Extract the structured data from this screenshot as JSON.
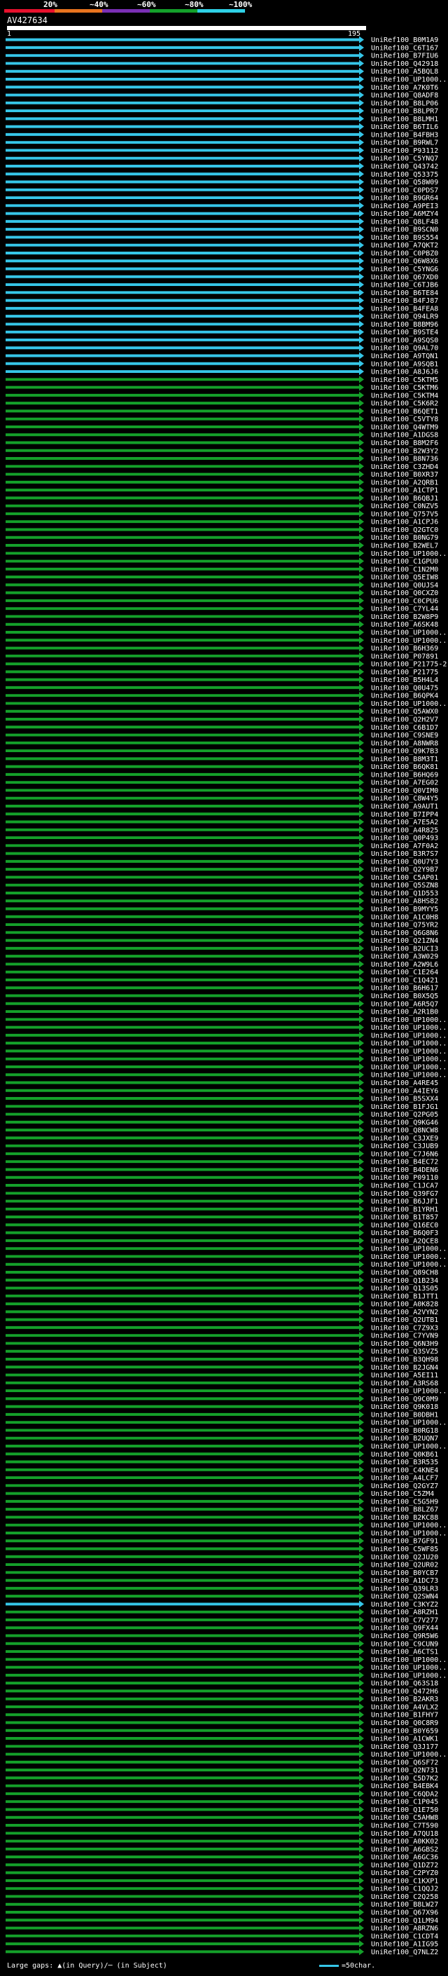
{
  "legend": {
    "labels": [
      "20%",
      "~40%",
      "~60%",
      "~80%",
      "~100%"
    ],
    "colors": [
      "#e8112d",
      "#e8741f",
      "#7a2fb5",
      "#14a02a",
      "#2fd0e6"
    ]
  },
  "query": {
    "id": "AV427634",
    "start": "1",
    "end": "195"
  },
  "hits": [
    {
      "name": "UniRef100_B0M1A9",
      "color": "#36c6e8"
    },
    {
      "name": "UniRef100_C6T167",
      "color": "#36c6e8"
    },
    {
      "name": "UniRef100_B7FIU6",
      "color": "#36c6e8"
    },
    {
      "name": "UniRef100_Q42918",
      "color": "#36c6e8"
    },
    {
      "name": "UniRef100_A5BQL8",
      "color": "#36c6e8"
    },
    {
      "name": "UniRef100_UP1000..",
      "color": "#36c6e8"
    },
    {
      "name": "UniRef100_A7K0T6",
      "color": "#36c6e8"
    },
    {
      "name": "UniRef100_Q8ADF8",
      "color": "#36c6e8"
    },
    {
      "name": "UniRef100_B8LP06",
      "color": "#36c6e8"
    },
    {
      "name": "UniRef100_B8LPR7",
      "color": "#36c6e8"
    },
    {
      "name": "UniRef100_B8LMH1",
      "color": "#36c6e8"
    },
    {
      "name": "UniRef100_B6TIL6",
      "color": "#36c6e8"
    },
    {
      "name": "UniRef100_B4FBH3",
      "color": "#36c6e8"
    },
    {
      "name": "UniRef100_B9RWL7",
      "color": "#36c6e8"
    },
    {
      "name": "UniRef100_P93112",
      "color": "#36c6e8"
    },
    {
      "name": "UniRef100_C5YNQ7",
      "color": "#36c6e8"
    },
    {
      "name": "UniRef100_Q43742",
      "color": "#36c6e8"
    },
    {
      "name": "UniRef100_Q53375",
      "color": "#36c6e8"
    },
    {
      "name": "UniRef100_Q58W09",
      "color": "#36c6e8"
    },
    {
      "name": "UniRef100_C0PDS7",
      "color": "#36c6e8"
    },
    {
      "name": "UniRef100_B9GR64",
      "color": "#36c6e8"
    },
    {
      "name": "UniRef100_A9PEI3",
      "color": "#36c6e8"
    },
    {
      "name": "UniRef100_A6MZY4",
      "color": "#36c6e8"
    },
    {
      "name": "UniRef100_Q8LF48",
      "color": "#36c6e8"
    },
    {
      "name": "UniRef100_B9SCN0",
      "color": "#36c6e8"
    },
    {
      "name": "UniRef100_B9S554",
      "color": "#36c6e8"
    },
    {
      "name": "UniRef100_A7QKT2",
      "color": "#36c6e8"
    },
    {
      "name": "UniRef100_C0PBZ0",
      "color": "#36c6e8"
    },
    {
      "name": "UniRef100_Q6W8X6",
      "color": "#36c6e8"
    },
    {
      "name": "UniRef100_C5YNG6",
      "color": "#36c6e8"
    },
    {
      "name": "UniRef100_Q67XD0",
      "color": "#36c6e8"
    },
    {
      "name": "UniRef100_C6TJB6",
      "color": "#36c6e8"
    },
    {
      "name": "UniRef100_B6TE84",
      "color": "#36c6e8"
    },
    {
      "name": "UniRef100_B4FJ87",
      "color": "#36c6e8"
    },
    {
      "name": "UniRef100_B4FEA8",
      "color": "#36c6e8"
    },
    {
      "name": "UniRef100_Q94LR9",
      "color": "#36c6e8"
    },
    {
      "name": "UniRef100_B8BM96",
      "color": "#36c6e8"
    },
    {
      "name": "UniRef100_B9STE4",
      "color": "#36c6e8"
    },
    {
      "name": "UniRef100_A9SQS0",
      "color": "#36c6e8"
    },
    {
      "name": "UniRef100_Q9AL70",
      "color": "#36c6e8"
    },
    {
      "name": "UniRef100_A9TQN1",
      "color": "#36c6e8"
    },
    {
      "name": "UniRef100_A9SQB1",
      "color": "#36c6e8"
    },
    {
      "name": "UniRef100_A8J6J6",
      "color": "#36c6e8"
    },
    {
      "name": "UniRef100_C5KTM5",
      "color": "#14a02a"
    },
    {
      "name": "UniRef100_C5KTM6",
      "color": "#14a02a"
    },
    {
      "name": "UniRef100_C5KTM4",
      "color": "#14a02a"
    },
    {
      "name": "UniRef100_C5K6R2",
      "color": "#14a02a"
    },
    {
      "name": "UniRef100_B6QET1",
      "color": "#14a02a"
    },
    {
      "name": "UniRef100_C5VTY8",
      "color": "#14a02a"
    },
    {
      "name": "UniRef100_Q4WTM9",
      "color": "#14a02a"
    },
    {
      "name": "UniRef100_A1DGS8",
      "color": "#14a02a"
    },
    {
      "name": "UniRef100_B8M2F6",
      "color": "#14a02a"
    },
    {
      "name": "UniRef100_B2W3Y2",
      "color": "#14a02a"
    },
    {
      "name": "UniRef100_B8N736",
      "color": "#14a02a"
    },
    {
      "name": "UniRef100_C3ZHD4",
      "color": "#14a02a"
    },
    {
      "name": "UniRef100_B0XR37",
      "color": "#14a02a"
    },
    {
      "name": "UniRef100_A2QRB1",
      "color": "#14a02a"
    },
    {
      "name": "UniRef100_A1CTP1",
      "color": "#14a02a"
    },
    {
      "name": "UniRef100_B6QBJ1",
      "color": "#14a02a"
    },
    {
      "name": "UniRef100_C0NZV5",
      "color": "#14a02a"
    },
    {
      "name": "UniRef100_Q757V5",
      "color": "#14a02a"
    },
    {
      "name": "UniRef100_A1CPJ6",
      "color": "#14a02a"
    },
    {
      "name": "UniRef100_Q2GTC0",
      "color": "#14a02a"
    },
    {
      "name": "UniRef100_B0NG79",
      "color": "#14a02a"
    },
    {
      "name": "UniRef100_B2WEL7",
      "color": "#14a02a"
    },
    {
      "name": "UniRef100_UP1000..",
      "color": "#14a02a"
    },
    {
      "name": "UniRef100_C1GPU0",
      "color": "#14a02a"
    },
    {
      "name": "UniRef100_C1N2M0",
      "color": "#14a02a"
    },
    {
      "name": "UniRef100_Q5EIW8",
      "color": "#14a02a"
    },
    {
      "name": "UniRef100_Q0UJS4",
      "color": "#14a02a"
    },
    {
      "name": "UniRef100_Q0CXZ0",
      "color": "#14a02a"
    },
    {
      "name": "UniRef100_C0CPU6",
      "color": "#14a02a"
    },
    {
      "name": "UniRef100_C7YL44",
      "color": "#14a02a"
    },
    {
      "name": "UniRef100_B2W8P9",
      "color": "#14a02a"
    },
    {
      "name": "UniRef100_A6SK48",
      "color": "#14a02a"
    },
    {
      "name": "UniRef100_UP1000..",
      "color": "#14a02a"
    },
    {
      "name": "UniRef100_UP1000..",
      "color": "#14a02a"
    },
    {
      "name": "UniRef100_B6H369",
      "color": "#14a02a"
    },
    {
      "name": "UniRef100_P07891",
      "color": "#14a02a"
    },
    {
      "name": "UniRef100_P21775-2",
      "color": "#14a02a"
    },
    {
      "name": "UniRef100_P21775",
      "color": "#14a02a"
    },
    {
      "name": "UniRef100_B5H4L4",
      "color": "#14a02a"
    },
    {
      "name": "UniRef100_Q0U475",
      "color": "#14a02a"
    },
    {
      "name": "UniRef100_B6QPK4",
      "color": "#14a02a"
    },
    {
      "name": "UniRef100_UP1000..",
      "color": "#14a02a"
    },
    {
      "name": "UniRef100_Q5AWX0",
      "color": "#14a02a"
    },
    {
      "name": "UniRef100_Q2H2V7",
      "color": "#14a02a"
    },
    {
      "name": "UniRef100_C6B1D7",
      "color": "#14a02a"
    },
    {
      "name": "UniRef100_C9SNE9",
      "color": "#14a02a"
    },
    {
      "name": "UniRef100_A8NWR8",
      "color": "#14a02a"
    },
    {
      "name": "UniRef100_Q9K7B3",
      "color": "#14a02a"
    },
    {
      "name": "UniRef100_B8M3T1",
      "color": "#14a02a"
    },
    {
      "name": "UniRef100_B6QK81",
      "color": "#14a02a"
    },
    {
      "name": "UniRef100_B6HQ69",
      "color": "#14a02a"
    },
    {
      "name": "UniRef100_A7EG02",
      "color": "#14a02a"
    },
    {
      "name": "UniRef100_Q0VIM0",
      "color": "#14a02a"
    },
    {
      "name": "UniRef100_C8W4Y5",
      "color": "#14a02a"
    },
    {
      "name": "UniRef100_A9AUT1",
      "color": "#14a02a"
    },
    {
      "name": "UniRef100_B7IPP4",
      "color": "#14a02a"
    },
    {
      "name": "UniRef100_A7E5A2",
      "color": "#14a02a"
    },
    {
      "name": "UniRef100_A4R825",
      "color": "#14a02a"
    },
    {
      "name": "UniRef100_Q0P493",
      "color": "#14a02a"
    },
    {
      "name": "UniRef100_A7F0A2",
      "color": "#14a02a"
    },
    {
      "name": "UniRef100_B3R7S7",
      "color": "#14a02a"
    },
    {
      "name": "UniRef100_Q0U7Y3",
      "color": "#14a02a"
    },
    {
      "name": "UniRef100_Q2Y9B7",
      "color": "#14a02a"
    },
    {
      "name": "UniRef100_C5AP01",
      "color": "#14a02a"
    },
    {
      "name": "UniRef100_Q5SZN8",
      "color": "#14a02a"
    },
    {
      "name": "UniRef100_Q1D553",
      "color": "#14a02a"
    },
    {
      "name": "UniRef100_A8HS82",
      "color": "#14a02a"
    },
    {
      "name": "UniRef100_B9MYY5",
      "color": "#14a02a"
    },
    {
      "name": "UniRef100_A1C0H8",
      "color": "#14a02a"
    },
    {
      "name": "UniRef100_Q75YR2",
      "color": "#14a02a"
    },
    {
      "name": "UniRef100_Q6G8N6",
      "color": "#14a02a"
    },
    {
      "name": "UniRef100_Q21ZN4",
      "color": "#14a02a"
    },
    {
      "name": "UniRef100_B2UCI3",
      "color": "#14a02a"
    },
    {
      "name": "UniRef100_A3W029",
      "color": "#14a02a"
    },
    {
      "name": "UniRef100_A2W9L6",
      "color": "#14a02a"
    },
    {
      "name": "UniRef100_C1E264",
      "color": "#14a02a"
    },
    {
      "name": "UniRef100_C1Q421",
      "color": "#14a02a"
    },
    {
      "name": "UniRef100_B6H617",
      "color": "#14a02a"
    },
    {
      "name": "UniRef100_B0X5Q5",
      "color": "#14a02a"
    },
    {
      "name": "UniRef100_A6R5Q7",
      "color": "#14a02a"
    },
    {
      "name": "UniRef100_A2R1B0",
      "color": "#14a02a"
    },
    {
      "name": "UniRef100_UP1000..",
      "color": "#14a02a"
    },
    {
      "name": "UniRef100_UP1000..",
      "color": "#14a02a"
    },
    {
      "name": "UniRef100_UP1000..",
      "color": "#14a02a"
    },
    {
      "name": "UniRef100_UP1000..",
      "color": "#14a02a"
    },
    {
      "name": "UniRef100_UP1000..",
      "color": "#14a02a"
    },
    {
      "name": "UniRef100_UP1000..",
      "color": "#14a02a"
    },
    {
      "name": "UniRef100_UP1000..",
      "color": "#14a02a"
    },
    {
      "name": "UniRef100_UP1000..",
      "color": "#14a02a"
    },
    {
      "name": "UniRef100_A4RE45",
      "color": "#14a02a"
    },
    {
      "name": "UniRef100_A4IEY6",
      "color": "#14a02a"
    },
    {
      "name": "UniRef100_B5SXX4",
      "color": "#14a02a"
    },
    {
      "name": "UniRef100_B1FJG1",
      "color": "#14a02a"
    },
    {
      "name": "UniRef100_Q2PG05",
      "color": "#14a02a"
    },
    {
      "name": "UniRef100_Q9KG46",
      "color": "#14a02a"
    },
    {
      "name": "UniRef100_Q8NCW8",
      "color": "#14a02a"
    },
    {
      "name": "UniRef100_C3JXE9",
      "color": "#14a02a"
    },
    {
      "name": "UniRef100_C3JUB9",
      "color": "#14a02a"
    },
    {
      "name": "UniRef100_C7J6N6",
      "color": "#14a02a"
    },
    {
      "name": "UniRef100_B4EC72",
      "color": "#14a02a"
    },
    {
      "name": "UniRef100_B4DEN6",
      "color": "#14a02a"
    },
    {
      "name": "UniRef100_P09110",
      "color": "#14a02a"
    },
    {
      "name": "UniRef100_C1JCA7",
      "color": "#14a02a"
    },
    {
      "name": "UniRef100_Q39FG7",
      "color": "#14a02a"
    },
    {
      "name": "UniRef100_B6JJF1",
      "color": "#14a02a"
    },
    {
      "name": "UniRef100_B1YRH1",
      "color": "#14a02a"
    },
    {
      "name": "UniRef100_B1T857",
      "color": "#14a02a"
    },
    {
      "name": "UniRef100_Q16EC0",
      "color": "#14a02a"
    },
    {
      "name": "UniRef100_B6Q0F3",
      "color": "#14a02a"
    },
    {
      "name": "UniRef100_A2QCE8",
      "color": "#14a02a"
    },
    {
      "name": "UniRef100_UP1000..",
      "color": "#14a02a"
    },
    {
      "name": "UniRef100_UP1000..",
      "color": "#14a02a"
    },
    {
      "name": "UniRef100_UP1000..",
      "color": "#14a02a"
    },
    {
      "name": "UniRef100_Q89CH8",
      "color": "#14a02a"
    },
    {
      "name": "UniRef100_Q1B234",
      "color": "#14a02a"
    },
    {
      "name": "UniRef100_Q13S05",
      "color": "#14a02a"
    },
    {
      "name": "UniRef100_B1JTT1",
      "color": "#14a02a"
    },
    {
      "name": "UniRef100_A0K828",
      "color": "#14a02a"
    },
    {
      "name": "UniRef100_A2VYN2",
      "color": "#14a02a"
    },
    {
      "name": "UniRef100_Q2UTB1",
      "color": "#14a02a"
    },
    {
      "name": "UniRef100_C7Z9X3",
      "color": "#14a02a"
    },
    {
      "name": "UniRef100_C7YVN9",
      "color": "#14a02a"
    },
    {
      "name": "UniRef100_Q6N3H9",
      "color": "#14a02a"
    },
    {
      "name": "UniRef100_Q3SVZ5",
      "color": "#14a02a"
    },
    {
      "name": "UniRef100_B3QH98",
      "color": "#14a02a"
    },
    {
      "name": "UniRef100_B2JGN4",
      "color": "#14a02a"
    },
    {
      "name": "UniRef100_A5EI11",
      "color": "#14a02a"
    },
    {
      "name": "UniRef100_A3RS68",
      "color": "#14a02a"
    },
    {
      "name": "UniRef100_UP1000..",
      "color": "#14a02a"
    },
    {
      "name": "UniRef100_Q9C0M9",
      "color": "#14a02a"
    },
    {
      "name": "UniRef100_Q9K018",
      "color": "#14a02a"
    },
    {
      "name": "UniRef100_B0DBH1",
      "color": "#14a02a"
    },
    {
      "name": "UniRef100_UP1000..",
      "color": "#14a02a"
    },
    {
      "name": "UniRef100_B0RG18",
      "color": "#14a02a"
    },
    {
      "name": "UniRef100_B2UQN7",
      "color": "#14a02a"
    },
    {
      "name": "UniRef100_UP1000..",
      "color": "#14a02a"
    },
    {
      "name": "UniRef100_Q0KB61",
      "color": "#14a02a"
    },
    {
      "name": "UniRef100_B3R535",
      "color": "#14a02a"
    },
    {
      "name": "UniRef100_C4KNE4",
      "color": "#14a02a"
    },
    {
      "name": "UniRef100_A4LCF7",
      "color": "#14a02a"
    },
    {
      "name": "UniRef100_Q2GYZ7",
      "color": "#14a02a"
    },
    {
      "name": "UniRef100_C5ZM4",
      "color": "#14a02a"
    },
    {
      "name": "UniRef100_C5G5H9",
      "color": "#14a02a"
    },
    {
      "name": "UniRef100_B8LZ67",
      "color": "#14a02a"
    },
    {
      "name": "UniRef100_B2KC88",
      "color": "#14a02a"
    },
    {
      "name": "UniRef100_UP1000..",
      "color": "#14a02a"
    },
    {
      "name": "UniRef100_UP1000..",
      "color": "#14a02a"
    },
    {
      "name": "UniRef100_B7GF91",
      "color": "#14a02a"
    },
    {
      "name": "UniRef100_C5WF85",
      "color": "#14a02a"
    },
    {
      "name": "UniRef100_Q2JU20",
      "color": "#14a02a"
    },
    {
      "name": "UniRef100_Q2UR02",
      "color": "#14a02a"
    },
    {
      "name": "UniRef100_B0YCB7",
      "color": "#14a02a"
    },
    {
      "name": "UniRef100_A1DC73",
      "color": "#14a02a"
    },
    {
      "name": "UniRef100_Q39LR3",
      "color": "#14a02a"
    },
    {
      "name": "UniRef100_Q2SWN4",
      "color": "#14a02a"
    },
    {
      "name": "UniRef100_C3KYZ2",
      "color": "#36c6e8"
    },
    {
      "name": "UniRef100_A8RZH1",
      "color": "#14a02a"
    },
    {
      "name": "UniRef100_C7V277",
      "color": "#14a02a"
    },
    {
      "name": "UniRef100_Q9FX44",
      "color": "#14a02a"
    },
    {
      "name": "UniRef100_Q9R5W6",
      "color": "#14a02a"
    },
    {
      "name": "UniRef100_C9CUN9",
      "color": "#14a02a"
    },
    {
      "name": "UniRef100_A6CTS1",
      "color": "#14a02a"
    },
    {
      "name": "UniRef100_UP1000..",
      "color": "#14a02a"
    },
    {
      "name": "UniRef100_UP1000..",
      "color": "#14a02a"
    },
    {
      "name": "UniRef100_UP1000..",
      "color": "#14a02a"
    },
    {
      "name": "UniRef100_Q63S18",
      "color": "#14a02a"
    },
    {
      "name": "UniRef100_Q472H6",
      "color": "#14a02a"
    },
    {
      "name": "UniRef100_B2AKR3",
      "color": "#14a02a"
    },
    {
      "name": "UniRef100_A4VLX2",
      "color": "#14a02a"
    },
    {
      "name": "UniRef100_B1FHY7",
      "color": "#14a02a"
    },
    {
      "name": "UniRef100_Q0C8R9",
      "color": "#14a02a"
    },
    {
      "name": "UniRef100_B0Y659",
      "color": "#14a02a"
    },
    {
      "name": "UniRef100_A1CWK1",
      "color": "#14a02a"
    },
    {
      "name": "UniRef100_Q3J177",
      "color": "#14a02a"
    },
    {
      "name": "UniRef100_UP1000..",
      "color": "#14a02a"
    },
    {
      "name": "UniRef100_Q6SF72",
      "color": "#14a02a"
    },
    {
      "name": "UniRef100_Q2N731",
      "color": "#14a02a"
    },
    {
      "name": "UniRef100_C5D7K2",
      "color": "#14a02a"
    },
    {
      "name": "UniRef100_B4EBK4",
      "color": "#14a02a"
    },
    {
      "name": "UniRef100_C6QDA2",
      "color": "#14a02a"
    },
    {
      "name": "UniRef100_C1P045",
      "color": "#14a02a"
    },
    {
      "name": "UniRef100_Q1E750",
      "color": "#14a02a"
    },
    {
      "name": "UniRef100_C5AHW8",
      "color": "#14a02a"
    },
    {
      "name": "UniRef100_C7T590",
      "color": "#14a02a"
    },
    {
      "name": "UniRef100_A7QU18",
      "color": "#14a02a"
    },
    {
      "name": "UniRef100_A0KK02",
      "color": "#14a02a"
    },
    {
      "name": "UniRef100_A6GBS2",
      "color": "#14a02a"
    },
    {
      "name": "UniRef100_A6GC36",
      "color": "#14a02a"
    },
    {
      "name": "UniRef100_Q1DZ72",
      "color": "#14a02a"
    },
    {
      "name": "UniRef100_C2PYZ0",
      "color": "#14a02a"
    },
    {
      "name": "UniRef100_C1KXP1",
      "color": "#14a02a"
    },
    {
      "name": "UniRef100_C1QQJ2",
      "color": "#14a02a"
    },
    {
      "name": "UniRef100_C2Q258",
      "color": "#14a02a"
    },
    {
      "name": "UniRef100_B8LW27",
      "color": "#14a02a"
    },
    {
      "name": "UniRef100_Q67X96",
      "color": "#14a02a"
    },
    {
      "name": "UniRef100_Q1LM94",
      "color": "#14a02a"
    },
    {
      "name": "UniRef100_A8RZN6",
      "color": "#14a02a"
    },
    {
      "name": "UniRef100_C1CDT4",
      "color": "#14a02a"
    },
    {
      "name": "UniRef100_A1IG95",
      "color": "#14a02a"
    },
    {
      "name": "UniRef100_Q7NLZ2",
      "color": "#14a02a"
    }
  ],
  "footer": {
    "gaps_text": "Large gaps: ▲(in Query)/─ (in Subject)",
    "key_text": "=50char."
  }
}
